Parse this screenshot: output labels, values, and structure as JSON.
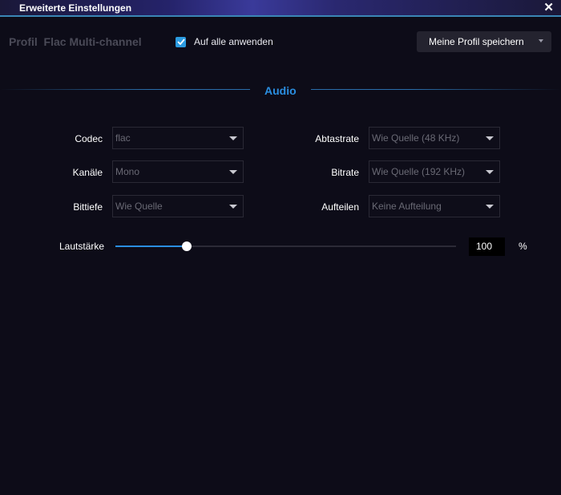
{
  "window": {
    "title": "Erweiterte Einstellungen",
    "close": "✕"
  },
  "header": {
    "profile_label": "Profil  Flac Multi-channel",
    "apply_all": {
      "label": "Auf alle anwenden",
      "checked": true
    },
    "save_profile_label": "Meine Profil speichern"
  },
  "section": {
    "title": "Audio"
  },
  "fields": {
    "codec": {
      "label": "Codec",
      "value": "flac"
    },
    "channels": {
      "label": "Kanäle",
      "value": "Mono"
    },
    "bit_depth": {
      "label": "Bittiefe",
      "value": "Wie Quelle"
    },
    "sample_rate": {
      "label": "Abtastrate",
      "value": "Wie Quelle (48 KHz)"
    },
    "bitrate": {
      "label": "Bitrate",
      "value": "Wie Quelle (192 KHz)"
    },
    "split": {
      "label": "Aufteilen",
      "value": "Keine Aufteilung"
    }
  },
  "volume": {
    "label": "Lautstärke",
    "value": "100",
    "unit": "%",
    "slider_fraction": 0.21
  },
  "colors": {
    "accent": "#2a8ee0",
    "background": "#0d0c18",
    "field_text": "#6a6a75"
  }
}
